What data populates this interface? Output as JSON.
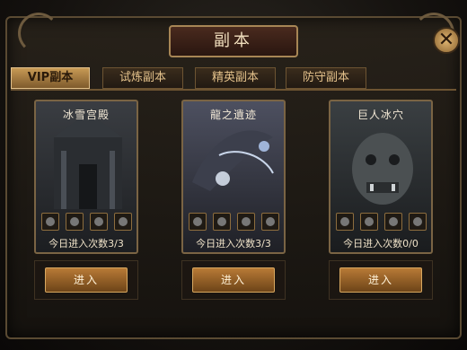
{
  "window": {
    "title": "副本",
    "close_icon": "close-icon"
  },
  "tabs": [
    {
      "label": "VIP副本",
      "active": true
    },
    {
      "label": "试炼副本",
      "active": false
    },
    {
      "label": "精英副本",
      "active": false
    },
    {
      "label": "防守副本",
      "active": false
    }
  ],
  "dungeons": [
    {
      "name": "冰雪宫殿",
      "count_text": "今日进入次数3/3",
      "button": "进入",
      "theme": "#4a4f56"
    },
    {
      "name": "龍之遺迹",
      "count_text": "今日进入次数3/3",
      "button": "进入",
      "theme": "#5c5f6e"
    },
    {
      "name": "巨人冰穴",
      "count_text": "今日进入次数0/0",
      "button": "进入",
      "theme": "#3e4346"
    }
  ],
  "colors": {
    "accent": "#c79a55",
    "frame": "#5a4a32",
    "text": "#f1dfbe"
  }
}
